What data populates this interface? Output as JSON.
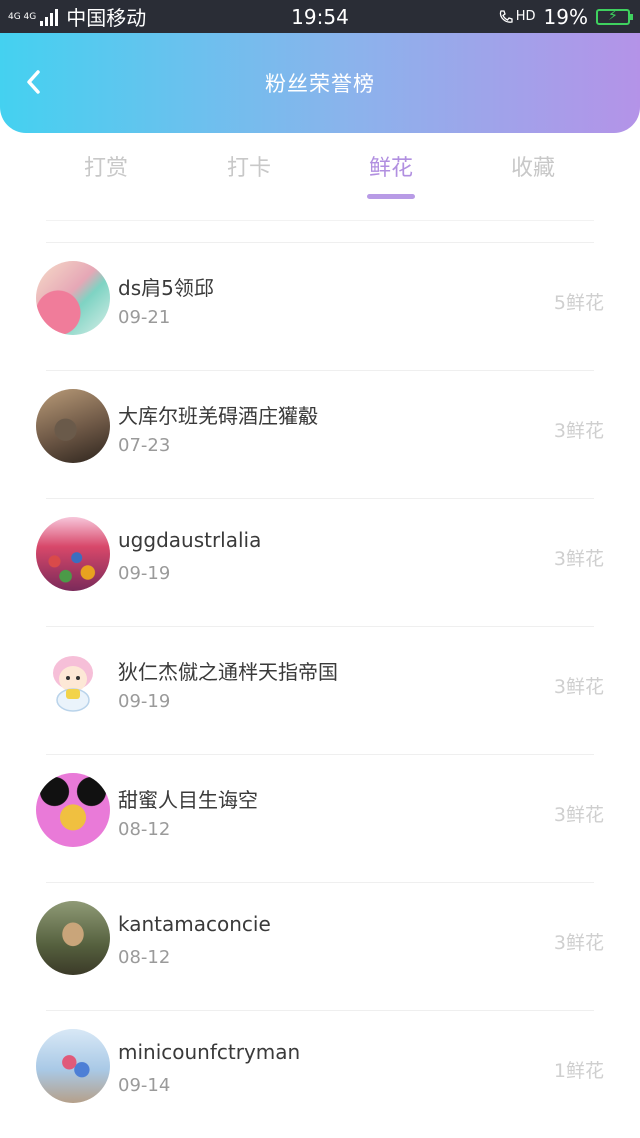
{
  "status_bar": {
    "network_top": "4G 4G",
    "carrier": "中国移动",
    "time": "19:54",
    "hd": "HD",
    "battery": "19%"
  },
  "header": {
    "title": "粉丝荣誉榜"
  },
  "tabs": [
    {
      "label": "打赏",
      "active": false
    },
    {
      "label": "打卡",
      "active": false
    },
    {
      "label": "鲜花",
      "active": true
    },
    {
      "label": "收藏",
      "active": false
    }
  ],
  "list": [
    {
      "name": "ds肩5领邱",
      "date": "09-21",
      "count": "5鲜花"
    },
    {
      "name": "大库尔班羌碍酒庄獾觳",
      "date": "07-23",
      "count": "3鲜花"
    },
    {
      "name": "uggdaustrlalia",
      "date": "09-19",
      "count": "3鲜花"
    },
    {
      "name": "狄仁杰僦之通柈天指帝国",
      "date": "09-19",
      "count": "3鲜花"
    },
    {
      "name": "甜蜜人目生诲空",
      "date": "08-12",
      "count": "3鲜花"
    },
    {
      "name": "kantamaconcie",
      "date": "08-12",
      "count": "3鲜花"
    },
    {
      "name": "minicounfctryman",
      "date": "09-14",
      "count": "1鲜花"
    }
  ],
  "colors": {
    "header_gradient_start": "#44d1f0",
    "header_gradient_end": "#b493e8",
    "tab_active": "#b18fe0",
    "tab_inactive": "#c8c8c8",
    "count_text": "#cfcfcf"
  }
}
